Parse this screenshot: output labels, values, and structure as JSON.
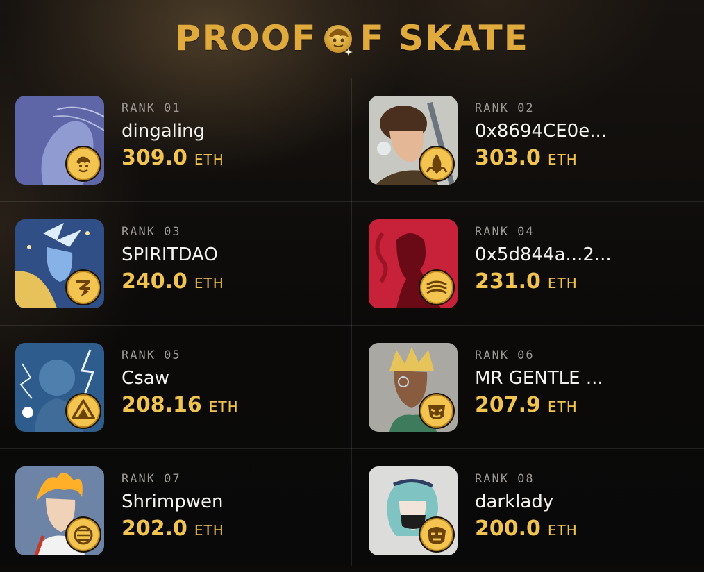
{
  "header": {
    "title_left": "PROOF",
    "title_right": "F SKATE",
    "logo_icon": "golden-lion-emblem-icon"
  },
  "colors": {
    "accent_gold": "#f1c452",
    "title_gold": "#e0ab3c",
    "rank_gray": "#9b9894",
    "name_white": "#f4f2ee"
  },
  "leaderboard": [
    {
      "rank_label": "RANK 01",
      "name": "dingaling",
      "amount": "309.0",
      "unit": "ETH",
      "avatar_bg": "#5e66a8",
      "badge_icon": "lion-badge-icon"
    },
    {
      "rank_label": "RANK 02",
      "name": "0x8694CE0e...",
      "amount": "303.0",
      "unit": "ETH",
      "avatar_bg": "#c7c8c2",
      "badge_icon": "flame-badge-icon"
    },
    {
      "rank_label": "RANK 03",
      "name": "SPIRITDAO",
      "amount": "240.0",
      "unit": "ETH",
      "avatar_bg": "#2f4f86",
      "badge_icon": "lightning-badge-icon"
    },
    {
      "rank_label": "RANK 04",
      "name": "0x5d844a...2...",
      "amount": "231.0",
      "unit": "ETH",
      "avatar_bg": "#c8213a",
      "badge_icon": "wave-badge-icon"
    },
    {
      "rank_label": "RANK 05",
      "name": "Csaw",
      "amount": "208.16",
      "unit": "ETH",
      "avatar_bg": "#2e5c8c",
      "badge_icon": "mountain-badge-icon"
    },
    {
      "rank_label": "RANK 06",
      "name": "MR GENTLE ...",
      "amount": "207.9",
      "unit": "ETH",
      "avatar_bg": "#a9a8a3",
      "badge_icon": "mask-badge-icon"
    },
    {
      "rank_label": "RANK 07",
      "name": "Shrimpwen",
      "amount": "202.0",
      "unit": "ETH",
      "avatar_bg": "#6d84a6",
      "badge_icon": "tiger-badge-icon"
    },
    {
      "rank_label": "RANK 08",
      "name": "darklady",
      "amount": "200.0",
      "unit": "ETH",
      "avatar_bg": "#dcdcda",
      "badge_icon": "oni-badge-icon"
    }
  ]
}
